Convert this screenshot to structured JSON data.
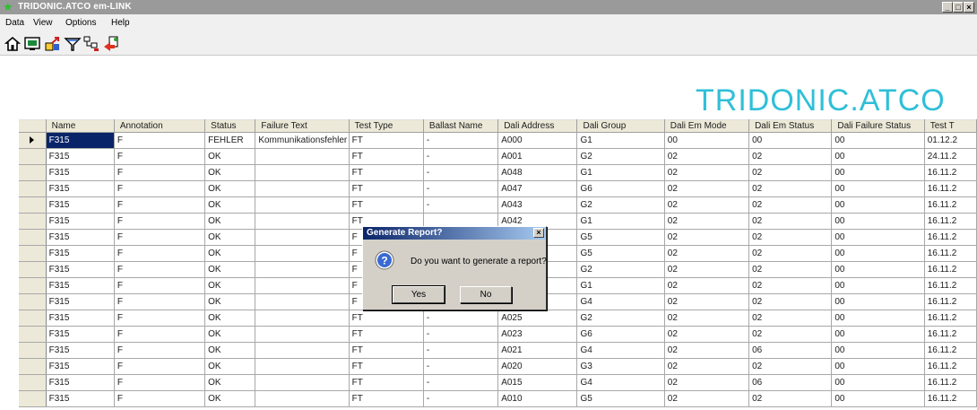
{
  "window": {
    "title": "TRIDONIC.ATCO em-LINK",
    "minimize": "_",
    "restore": "̸",
    "close": "×"
  },
  "menu": [
    "Data",
    "View",
    "Options",
    "Help"
  ],
  "toolbar_icons": [
    "home-icon",
    "monitor-icon",
    "export-icon",
    "filter-icon",
    "network-icon",
    "report-icon"
  ],
  "brand": "TRIDONIC.ATCO",
  "grid": {
    "columns": [
      "Name",
      "Annotation",
      "Status",
      "Failure Text",
      "Test Type",
      "Ballast Name",
      "Dali Address",
      "Dali Group",
      "Dali Em Mode",
      "Dali Em Status",
      "Dali Failure Status",
      "Test T"
    ],
    "rows": [
      [
        "F315",
        "F",
        "FEHLER",
        "Kommunikationsfehler",
        "FT",
        "-",
        "A000",
        "G1",
        "00",
        "00",
        "00",
        "01.12.2"
      ],
      [
        "F315",
        "F",
        "OK",
        "",
        "FT",
        "-",
        "A001",
        "G2",
        "02",
        "02",
        "00",
        "24.11.2"
      ],
      [
        "F315",
        "F",
        "OK",
        "",
        "FT",
        "-",
        "A048",
        "G1",
        "02",
        "02",
        "00",
        "16.11.2"
      ],
      [
        "F315",
        "F",
        "OK",
        "",
        "FT",
        "-",
        "A047",
        "G6",
        "02",
        "02",
        "00",
        "16.11.2"
      ],
      [
        "F315",
        "F",
        "OK",
        "",
        "FT",
        "-",
        "A043",
        "G2",
        "02",
        "02",
        "00",
        "16.11.2"
      ],
      [
        "F315",
        "F",
        "OK",
        "",
        "FT",
        "",
        "A042",
        "G1",
        "02",
        "02",
        "00",
        "16.11.2"
      ],
      [
        "F315",
        "F",
        "OK",
        "",
        "F",
        "",
        "",
        "G5",
        "02",
        "02",
        "00",
        "16.11.2"
      ],
      [
        "F315",
        "F",
        "OK",
        "",
        "F",
        "",
        "",
        "G5",
        "02",
        "02",
        "00",
        "16.11.2"
      ],
      [
        "F315",
        "F",
        "OK",
        "",
        "F",
        "",
        "",
        "G2",
        "02",
        "02",
        "00",
        "16.11.2"
      ],
      [
        "F315",
        "F",
        "OK",
        "",
        "F",
        "",
        "",
        "G1",
        "02",
        "02",
        "00",
        "16.11.2"
      ],
      [
        "F315",
        "F",
        "OK",
        "",
        "F",
        "",
        "",
        "G4",
        "02",
        "02",
        "00",
        "16.11.2"
      ],
      [
        "F315",
        "F",
        "OK",
        "",
        "FT",
        "-",
        "A025",
        "G2",
        "02",
        "02",
        "00",
        "16.11.2"
      ],
      [
        "F315",
        "F",
        "OK",
        "",
        "FT",
        "-",
        "A023",
        "G6",
        "02",
        "02",
        "00",
        "16.11.2"
      ],
      [
        "F315",
        "F",
        "OK",
        "",
        "FT",
        "-",
        "A021",
        "G4",
        "02",
        "06",
        "00",
        "16.11.2"
      ],
      [
        "F315",
        "F",
        "OK",
        "",
        "FT",
        "-",
        "A020",
        "G3",
        "02",
        "02",
        "00",
        "16.11.2"
      ],
      [
        "F315",
        "F",
        "OK",
        "",
        "FT",
        "-",
        "A015",
        "G4",
        "02",
        "06",
        "00",
        "16.11.2"
      ],
      [
        "F315",
        "F",
        "OK",
        "",
        "FT",
        "-",
        "A010",
        "G5",
        "02",
        "02",
        "00",
        "16.11.2"
      ]
    ]
  },
  "dialog": {
    "title": "Generate Report?",
    "message": "Do you want to generate a report?",
    "yes": "Yes",
    "no": "No",
    "close": "×"
  }
}
